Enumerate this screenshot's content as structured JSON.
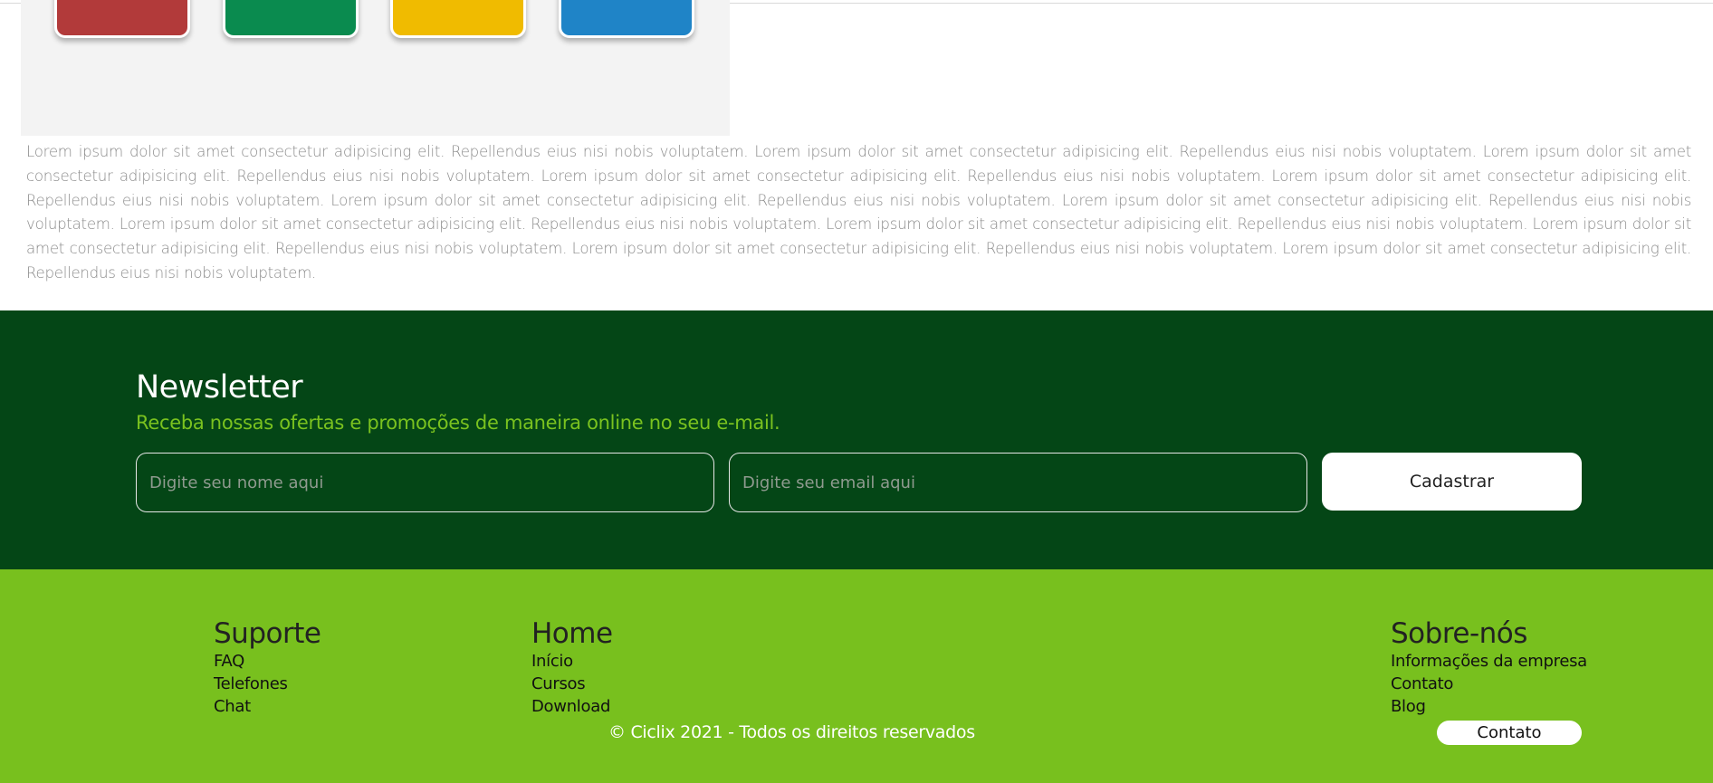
{
  "content": {
    "lorem_text": "Lorem ipsum dolor sit amet consectetur adipisicing elit. Repellendus eius nisi nobis voluptatem. Lorem ipsum dolor sit amet consectetur adipisicing elit. Repellendus eius nisi nobis voluptatem. Lorem ipsum dolor sit amet consectetur adipisicing elit. Repellendus eius nisi nobis voluptatem. Lorem ipsum dolor sit amet consectetur adipisicing elit. Repellendus eius nisi nobis voluptatem. Lorem ipsum dolor sit amet consectetur adipisicing elit. Repellendus eius nisi nobis voluptatem. Lorem ipsum dolor sit amet consectetur adipisicing elit. Repellendus eius nisi nobis voluptatem. Lorem ipsum dolor sit amet consectetur adipisicing elit. Repellendus eius nisi nobis voluptatem. Lorem ipsum dolor sit amet consectetur adipisicing elit. Repellendus eius nisi nobis voluptatem. Lorem ipsum dolor sit amet consectetur adipisicing elit. Repellendus eius nisi nobis voluptatem. Lorem ipsum dolor sit amet consectetur adipisicing elit. Repellendus eius nisi nobis voluptatem. Lorem ipsum dolor sit amet consectetur adipisicing elit. Repellendus eius nisi nobis voluptatem. Lorem ipsum dolor sit amet consectetur adipisicing elit. Repellendus eius nisi nobis voluptatem.",
    "hero_bin_colors": [
      "#b23a3a",
      "#0a8b4f",
      "#f0bb00",
      "#1f84c7"
    ]
  },
  "newsletter": {
    "title": "Newsletter",
    "subtitle": "Receba nossas ofertas e promoções de maneira online no seu e-mail.",
    "name_placeholder": "Digite seu nome aqui",
    "email_placeholder": "Digite seu email aqui",
    "submit_label": "Cadastrar",
    "background_color": "#044616",
    "accent_color": "#7ac21f"
  },
  "footer": {
    "background_color": "#78c01e",
    "columns": [
      {
        "title": "Suporte",
        "links": [
          "FAQ",
          "Telefones",
          "Chat"
        ]
      },
      {
        "title": "Home",
        "links": [
          "Início",
          "Cursos",
          "Download"
        ]
      },
      {
        "title": "Sobre-nós",
        "links": [
          "Informações da empresa",
          "Contato",
          "Blog"
        ]
      }
    ],
    "copyright": "© Ciclix 2021 - Todos os direitos reservados",
    "contact_button_label": "Contato"
  }
}
